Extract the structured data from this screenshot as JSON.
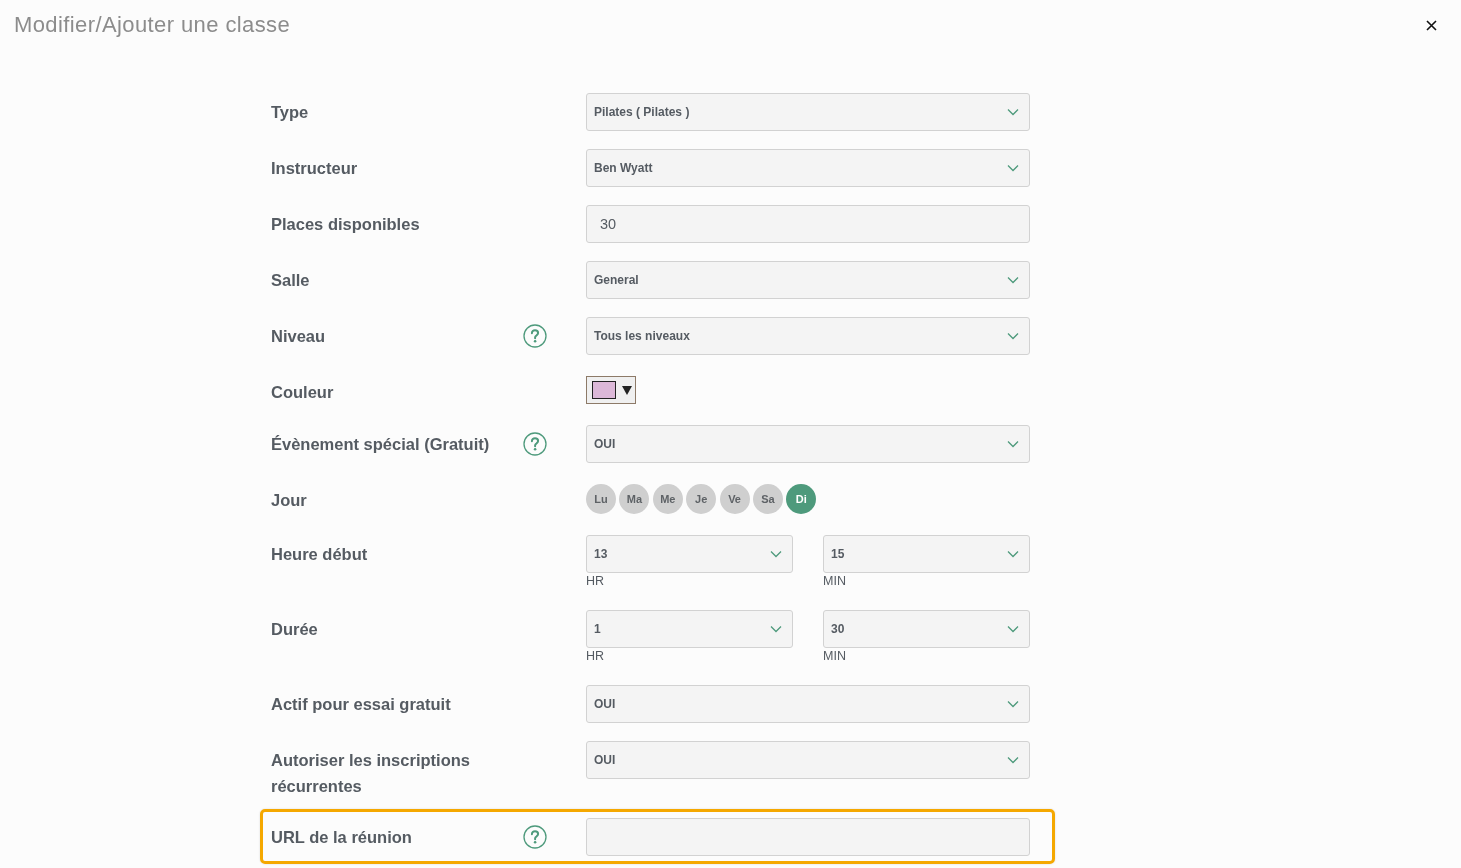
{
  "dialog": {
    "title": "Modifier/Ajouter une classe"
  },
  "fields": [
    {
      "kind": "select",
      "label": "Type",
      "help": false,
      "highlighted": false,
      "value": "Pilates ( Pilates )"
    },
    {
      "kind": "select",
      "label": "Instructeur",
      "help": false,
      "highlighted": false,
      "value": "Ben Wyatt"
    },
    {
      "kind": "input",
      "label": "Places disponibles",
      "help": false,
      "highlighted": false,
      "value": "30"
    },
    {
      "kind": "select",
      "label": "Salle",
      "help": false,
      "highlighted": false,
      "value": "General"
    },
    {
      "kind": "select",
      "label": "Niveau",
      "help": true,
      "highlighted": false,
      "value": "Tous les niveaux"
    },
    {
      "kind": "color",
      "label": "Couleur",
      "help": false,
      "highlighted": false,
      "color": "#dcb8d8"
    },
    {
      "kind": "select",
      "label": "Évènement spécial (Gratuit)",
      "help": true,
      "highlighted": false,
      "value": "OUI"
    },
    {
      "kind": "days",
      "label": "Jour",
      "help": false,
      "highlighted": false,
      "days": [
        {
          "label": "Lu",
          "selected": false
        },
        {
          "label": "Ma",
          "selected": false
        },
        {
          "label": "Me",
          "selected": false
        },
        {
          "label": "Je",
          "selected": false
        },
        {
          "label": "Ve",
          "selected": false
        },
        {
          "label": "Sa",
          "selected": false
        },
        {
          "label": "Di",
          "selected": true
        }
      ]
    },
    {
      "kind": "split",
      "label": "Heure début",
      "help": false,
      "highlighted": false,
      "parts": [
        {
          "value": "13",
          "unit": "HR"
        },
        {
          "value": "15",
          "unit": "MIN"
        }
      ]
    },
    {
      "kind": "split",
      "label": "Durée",
      "help": false,
      "highlighted": false,
      "parts": [
        {
          "value": "1",
          "unit": "HR"
        },
        {
          "value": "30",
          "unit": "MIN"
        }
      ]
    },
    {
      "kind": "select",
      "label": "Actif pour essai gratuit",
      "help": false,
      "highlighted": false,
      "value": "OUI"
    },
    {
      "kind": "select",
      "label": "Autoriser les inscriptions récurrentes",
      "help": false,
      "highlighted": false,
      "value": "OUI"
    },
    {
      "kind": "input",
      "label": "URL de la réunion",
      "help": true,
      "highlighted": true
    }
  ]
}
